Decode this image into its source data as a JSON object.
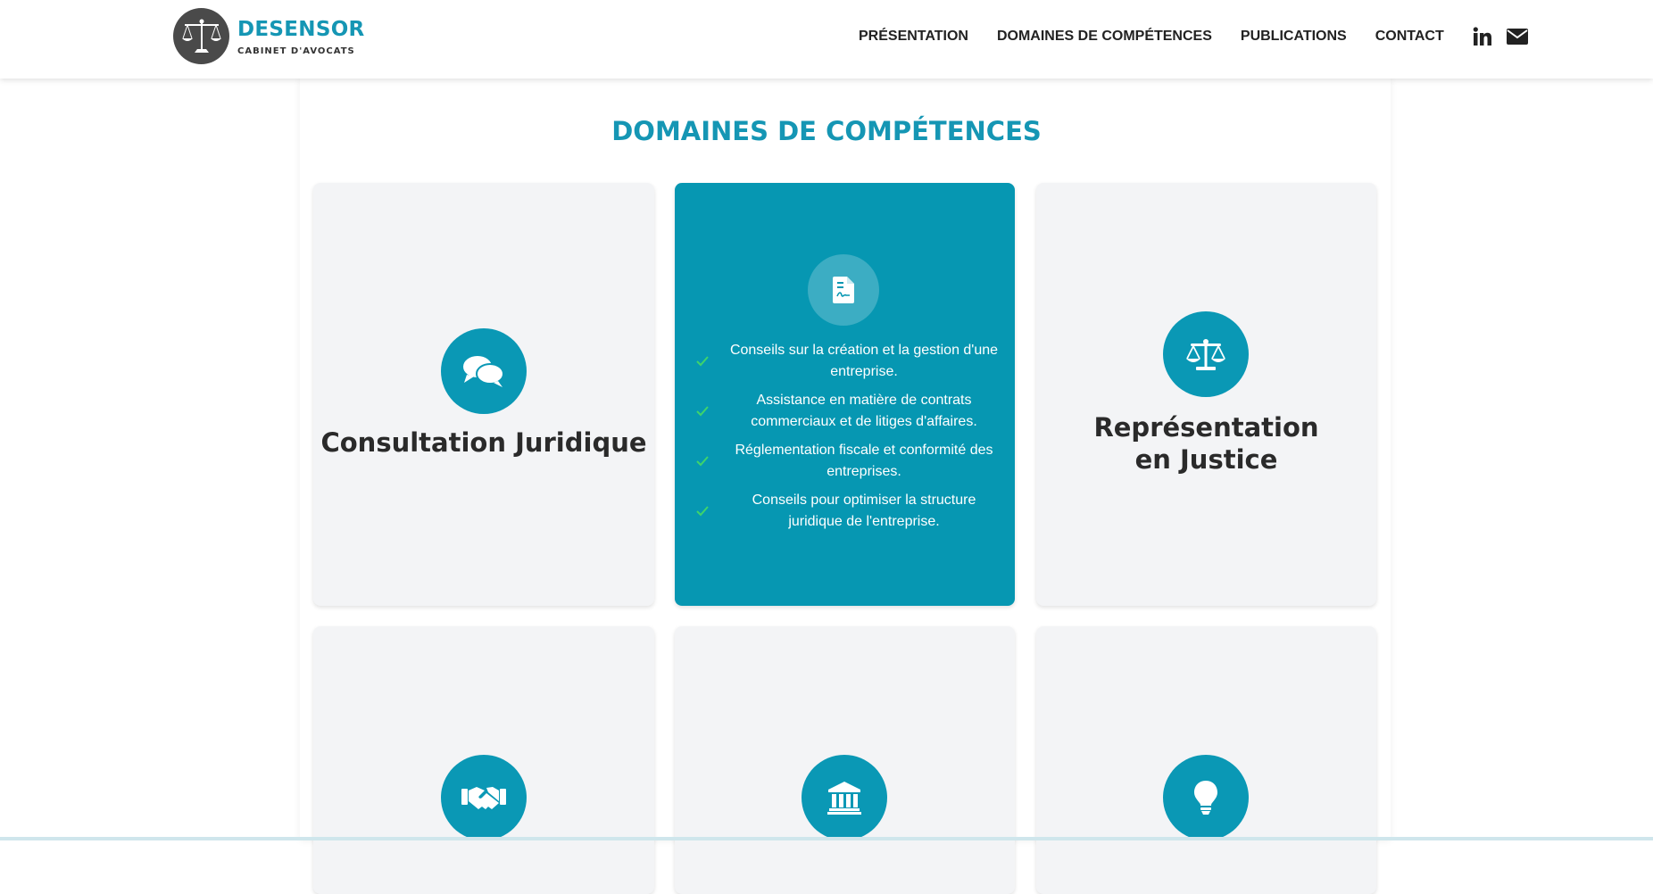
{
  "brand": {
    "name": "DESENSOR",
    "subtitle": "CABINET D'AVOCATS",
    "logo_icon": "scales-icon"
  },
  "nav": {
    "items": [
      "PRÉSENTATION",
      "DOMAINES DE COMPÉTENCES",
      "PUBLICATIONS",
      "CONTACT"
    ],
    "social": [
      "linkedin-icon",
      "envelope-icon"
    ]
  },
  "section": {
    "title": "DOMAINES DE COMPÉTENCES"
  },
  "cards": [
    {
      "title": "Consultation Juridique",
      "icon": "comments-icon"
    },
    {
      "icon": "file-signature-icon",
      "active": true,
      "bullets": [
        "Conseils sur la création et la gestion d'une entreprise.",
        "Assistance en matière de contrats commerciaux et de litiges d'affaires.",
        "Réglementation fiscale et conformité des entreprises.",
        "Conseils pour optimiser la structure juridique de l'entreprise."
      ]
    },
    {
      "title": "Représentation en Justice",
      "icon": "scale-balanced-icon"
    },
    {
      "icon": "handshake-icon"
    },
    {
      "icon": "landmark-icon"
    },
    {
      "icon": "lightbulb-icon"
    }
  ],
  "colors": {
    "accent": "#0a98b5",
    "card_bg": "#f3f4f6",
    "check": "#3fd46b"
  }
}
